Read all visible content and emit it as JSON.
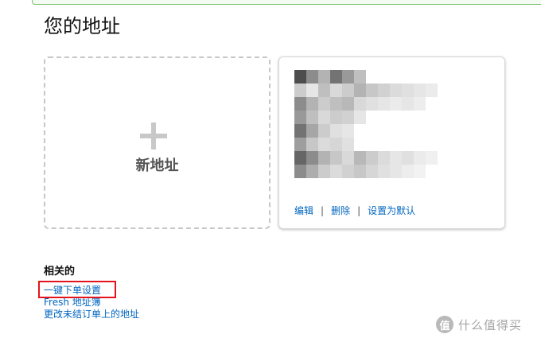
{
  "page": {
    "title": "您的地址"
  },
  "add_address": {
    "label": "新地址",
    "icon": "plus-icon"
  },
  "address_card": {
    "content": "",
    "actions": {
      "edit": "编辑",
      "delete": "删除",
      "set_default": "设置为默认",
      "separator": "|"
    }
  },
  "related": {
    "heading": "相关的",
    "links": [
      "一键下单设置",
      "Fresh 地址簿",
      "更改未结订单上的地址"
    ]
  },
  "watermark": {
    "logo_char": "值",
    "text": "什么值得买"
  },
  "colors": {
    "link": "#0066c0",
    "highlight": "#e3141e",
    "dashed_border": "#c7c7c7"
  }
}
